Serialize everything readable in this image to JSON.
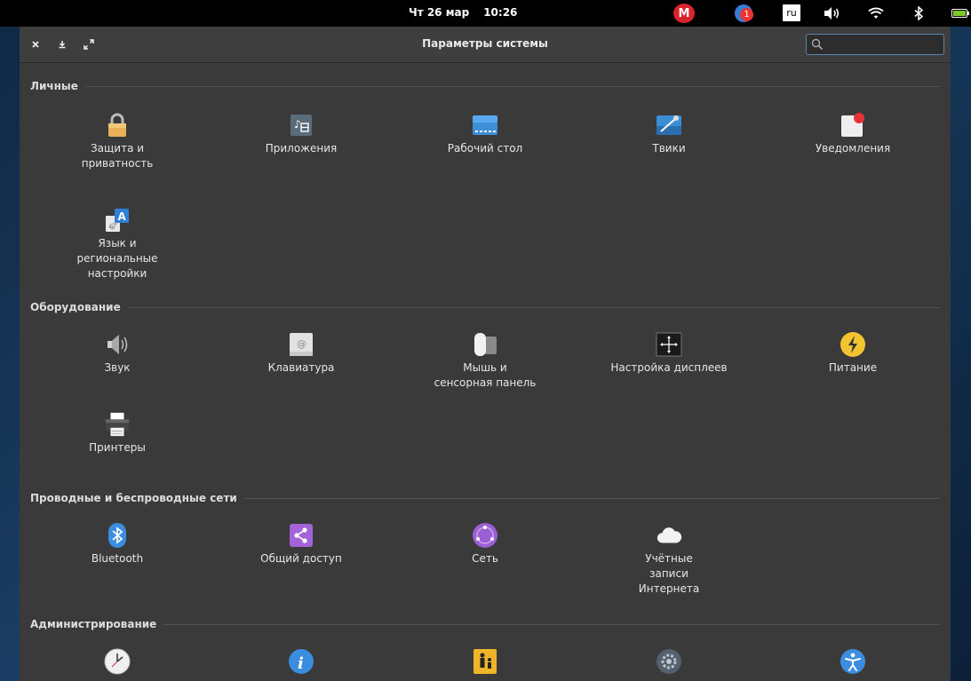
{
  "panel": {
    "date": "Чт 26 мар",
    "time": "10:26",
    "mega_label": "M",
    "notification_count": "1",
    "language": "ru"
  },
  "window": {
    "title": "Параметры системы",
    "search_value": ""
  },
  "sections": {
    "personal": {
      "title": "Личные",
      "items": [
        {
          "label": "Защита и\nприватность",
          "icon": "lock-icon"
        },
        {
          "label": "Приложения",
          "icon": "applications-icon"
        },
        {
          "label": "Рабочий стол",
          "icon": "desktop-icon"
        },
        {
          "label": "Твики",
          "icon": "tweaks-icon"
        },
        {
          "label": "Уведомления",
          "icon": "notifications-icon"
        },
        {
          "label": "Язык и\nрегиональные\nнастройки",
          "icon": "language-icon"
        }
      ]
    },
    "hardware": {
      "title": "Оборудование",
      "items": [
        {
          "label": "Звук",
          "icon": "sound-icon"
        },
        {
          "label": "Клавиатура",
          "icon": "keyboard-icon"
        },
        {
          "label": "Мышь и\nсенсорная панель",
          "icon": "mouse-icon"
        },
        {
          "label": "Настройка дисплеев",
          "icon": "display-icon"
        },
        {
          "label": "Питание",
          "icon": "power-icon"
        },
        {
          "label": "Принтеры",
          "icon": "printer-icon"
        }
      ]
    },
    "network": {
      "title": "Проводные и беспроводные сети",
      "items": [
        {
          "label": "Bluetooth",
          "icon": "bluetooth-icon"
        },
        {
          "label": "Общий доступ",
          "icon": "sharing-icon"
        },
        {
          "label": "Сеть",
          "icon": "network-icon"
        },
        {
          "label": "Учётные\nзаписи\nИнтернета",
          "icon": "online-accounts-icon"
        }
      ]
    },
    "admin": {
      "title": "Администрирование",
      "items": [
        {
          "label": "",
          "icon": "clock-icon"
        },
        {
          "label": "",
          "icon": "info-icon"
        },
        {
          "label": "",
          "icon": "parental-control-icon"
        },
        {
          "label": "",
          "icon": "gear-icon"
        },
        {
          "label": "",
          "icon": "accessibility-icon"
        }
      ]
    }
  }
}
